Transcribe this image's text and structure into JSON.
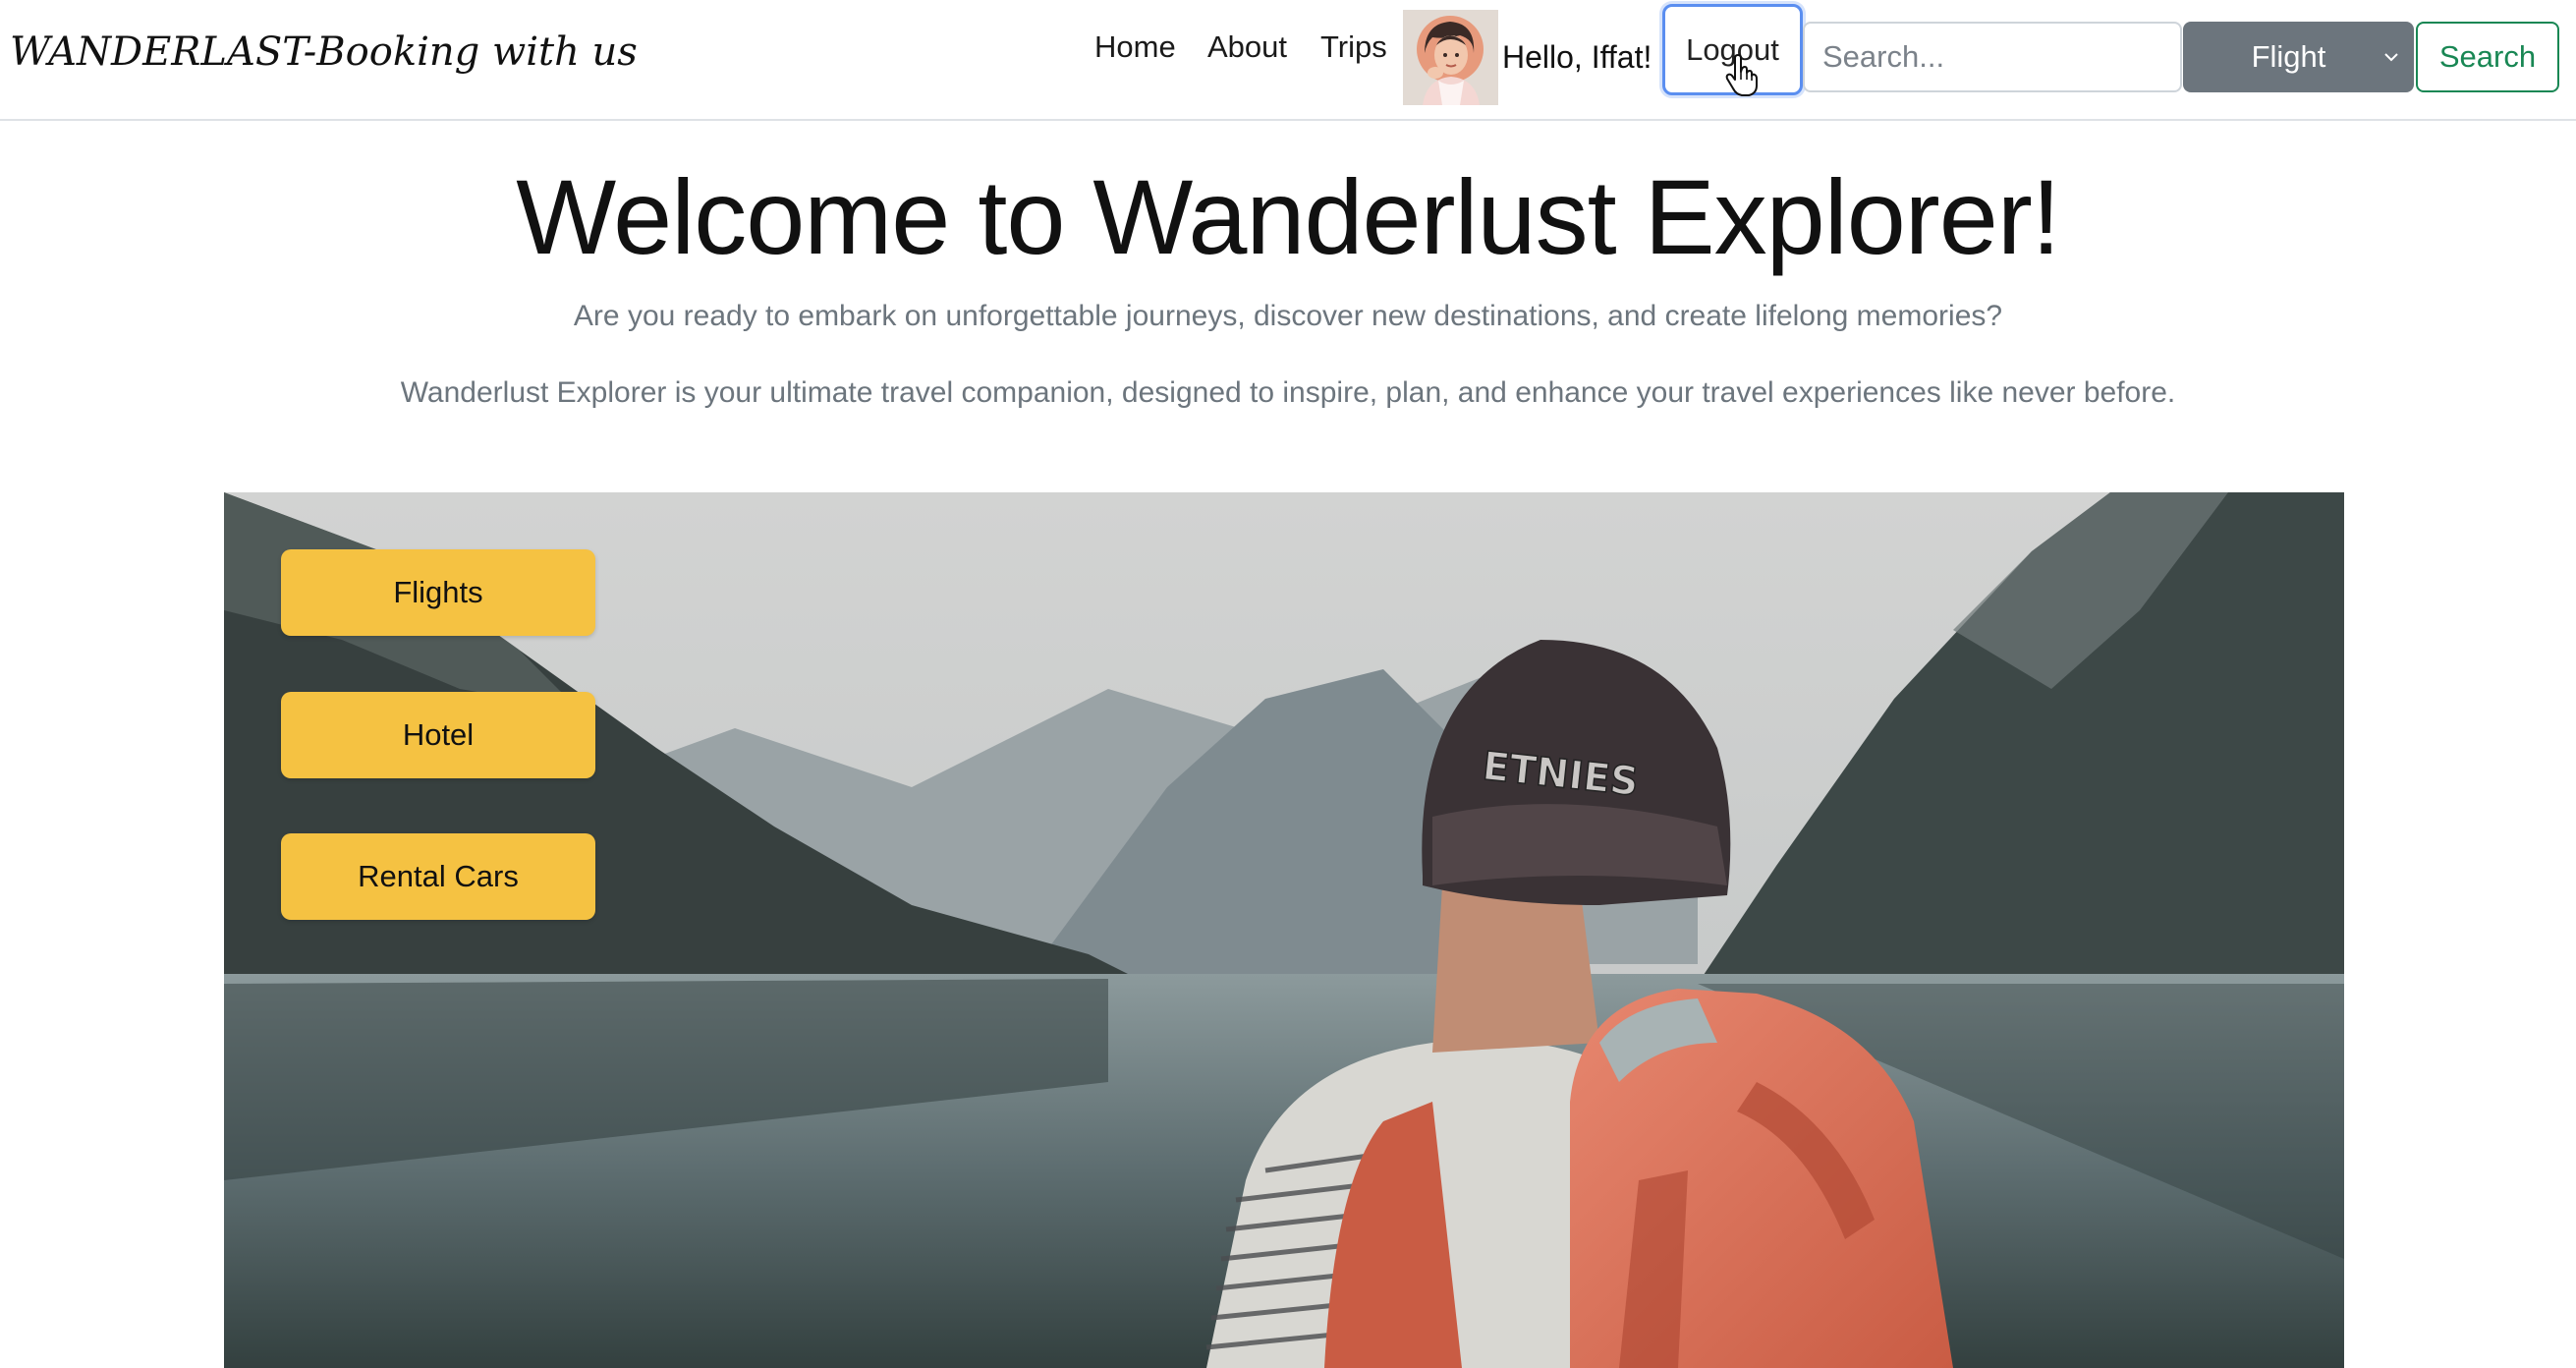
{
  "navbar": {
    "brand": "WANDERLAST-Booking with us",
    "links": [
      "Home",
      "About",
      "Trips"
    ],
    "greeting": "Hello, Iffat!",
    "logout_label": "Logout",
    "search_placeholder": "Search...",
    "search_type_selected": "Flight",
    "search_button_label": "Search"
  },
  "hero": {
    "title": "Welcome to Wanderlust Explorer!",
    "subtitle1": "Are you ready to embark on unforgettable journeys, discover new destinations, and create lifelong memories?",
    "subtitle2": "Wanderlust Explorer is your ultimate travel companion, designed to inspire, plan, and enhance your travel experiences like never before."
  },
  "categories": [
    "Flights",
    "Hotel",
    "Rental Cars"
  ],
  "photo": {
    "cap_text": "ETNIES"
  },
  "colors": {
    "accent_yellow": "#f5c242",
    "search_green": "#198754",
    "select_gray": "#6c757d",
    "focus_blue": "#5a8ef0"
  }
}
